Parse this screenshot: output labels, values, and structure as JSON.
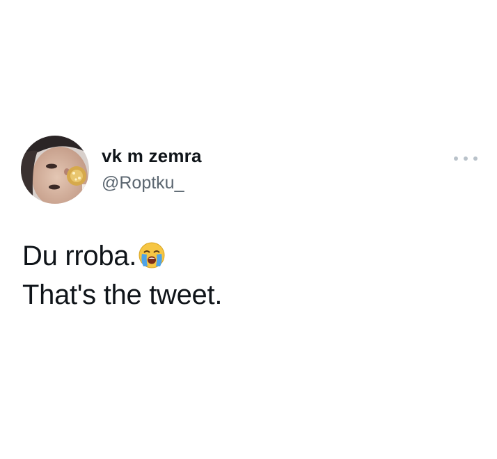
{
  "tweet": {
    "author": {
      "display_name": "vk m zemra",
      "handle": "@Roptku_"
    },
    "lines": [
      "Du rroba.",
      "That's the tweet."
    ],
    "emoji": "loudly-crying-face",
    "more_icon": "more-horizontal-icon"
  },
  "colors": {
    "text_primary": "#0f1419",
    "text_secondary": "#5b6670",
    "more_icon": "#b9c2ca",
    "background": "#ffffff"
  }
}
